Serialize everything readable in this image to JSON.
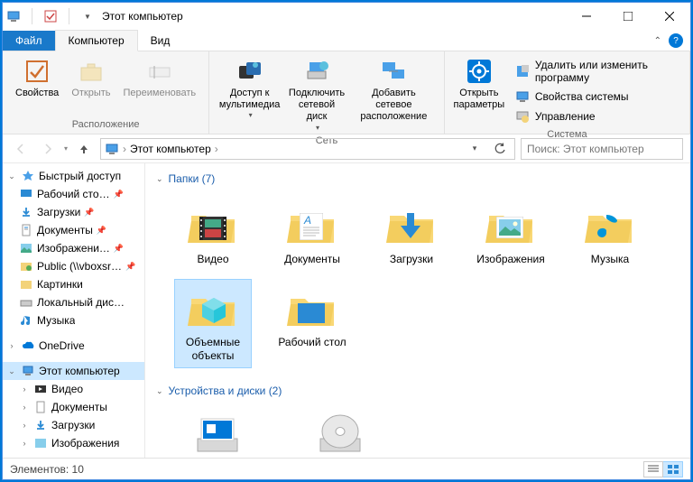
{
  "title": "Этот компьютер",
  "tabs": {
    "file": "Файл",
    "computer": "Компьютер",
    "view": "Вид"
  },
  "ribbon": {
    "location_group": "Расположение",
    "network_group": "Сеть",
    "system_group": "Система",
    "props": "Свойства",
    "open": "Открыть",
    "rename": "Переименовать",
    "media": "Доступ к\nмультимедиа",
    "mapdrive": "Подключить\nсетевой диск",
    "addnet": "Добавить сетевое\nрасположение",
    "settings": "Открыть\nпараметры",
    "uninstall": "Удалить или изменить программу",
    "sysprops": "Свойства системы",
    "manage": "Управление"
  },
  "breadcrumb": {
    "path": "Этот компьютер"
  },
  "search_placeholder": "Поиск: Этот компьютер",
  "sidebar": {
    "quick": "Быстрый доступ",
    "desktop": "Рабочий сто…",
    "downloads": "Загрузки",
    "documents": "Документы",
    "images": "Изображени…",
    "public": "Public (\\\\vboxsr…",
    "pictures": "Картинки",
    "localdisk": "Локальный дис…",
    "music": "Музыка",
    "onedrive": "OneDrive",
    "thispc": "Этот компьютер",
    "video": "Видео",
    "docs2": "Документы",
    "downloads2": "Загрузки",
    "images2": "Изображения"
  },
  "groups": {
    "folders": "Папки (7)",
    "drives": "Устройства и диски (2)"
  },
  "folders": {
    "video": "Видео",
    "documents": "Документы",
    "downloads": "Загрузки",
    "images": "Изображения",
    "music": "Музыка",
    "objects3d": "Объемные\nобъекты",
    "desktop": "Рабочий стол"
  },
  "status": "Элементов: 10"
}
